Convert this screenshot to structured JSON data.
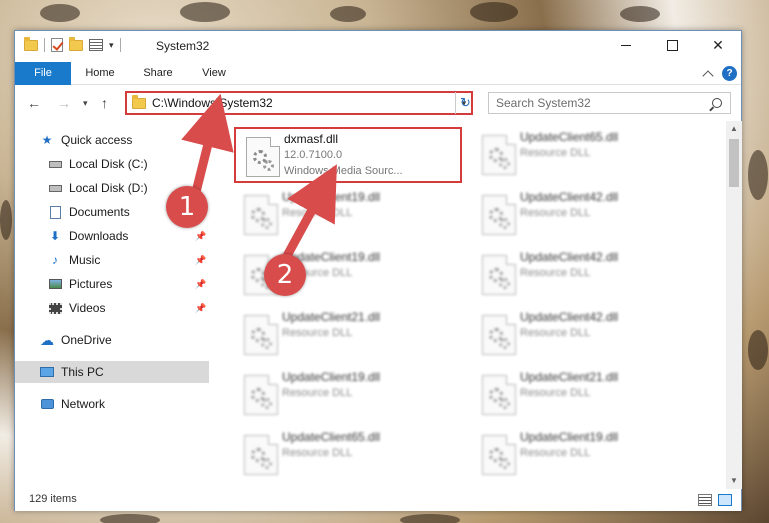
{
  "window": {
    "title": "System32"
  },
  "ribbon": {
    "tabs": [
      {
        "label": "File"
      },
      {
        "label": "Home"
      },
      {
        "label": "Share"
      },
      {
        "label": "View"
      }
    ],
    "help_label": "?"
  },
  "nav": {
    "address": "C:\\Windows\\System32",
    "search_placeholder": "Search System32"
  },
  "sidebar": {
    "items": [
      {
        "label": "Quick access",
        "icon": "star-icon"
      },
      {
        "label": "Local Disk (C:)",
        "icon": "drive-icon"
      },
      {
        "label": "Local Disk (D:)",
        "icon": "drive-icon"
      },
      {
        "label": "Documents",
        "icon": "documents-icon"
      },
      {
        "label": "Downloads",
        "icon": "download-arrow-icon"
      },
      {
        "label": "Music",
        "icon": "music-note-icon"
      },
      {
        "label": "Pictures",
        "icon": "pictures-icon"
      },
      {
        "label": "Videos",
        "icon": "film-icon"
      },
      {
        "label": "OneDrive",
        "icon": "cloud-icon"
      },
      {
        "label": "This PC",
        "icon": "monitor-icon"
      },
      {
        "label": "Network",
        "icon": "network-icon"
      }
    ]
  },
  "files": {
    "highlighted": {
      "name": "dxmasf.dll",
      "version": "12.0.7100.0",
      "description": "Windows Media Sourc..."
    },
    "blurred": [
      {
        "name": "UpdateClient65.dll",
        "type": "Resource DLL"
      },
      {
        "name": "UpdateClient19.dll",
        "type": "Resource DLL"
      },
      {
        "name": "UpdateClient42.dll",
        "type": "Resource DLL"
      },
      {
        "name": "UpdateClient19.dll",
        "type": "Resource DLL"
      },
      {
        "name": "UpdateClient42.dll",
        "type": "Resource DLL"
      },
      {
        "name": "UpdateClient21.dll",
        "type": "Resource DLL"
      },
      {
        "name": "UpdateClient42.dll",
        "type": "Resource DLL"
      },
      {
        "name": "UpdateClient19.dll",
        "type": "Resource DLL"
      },
      {
        "name": "UpdateClient21.dll",
        "type": "Resource DLL"
      },
      {
        "name": "UpdateClient65.dll",
        "type": "Resource DLL"
      },
      {
        "name": "UpdateClient19.dll",
        "type": "Resource DLL"
      }
    ]
  },
  "status": {
    "item_count": "129 items"
  },
  "annotations": {
    "badge1": "1",
    "badge2": "2"
  },
  "colors": {
    "accent": "#1979ca",
    "highlight": "#d43b3b",
    "badge": "#d94c4c"
  }
}
